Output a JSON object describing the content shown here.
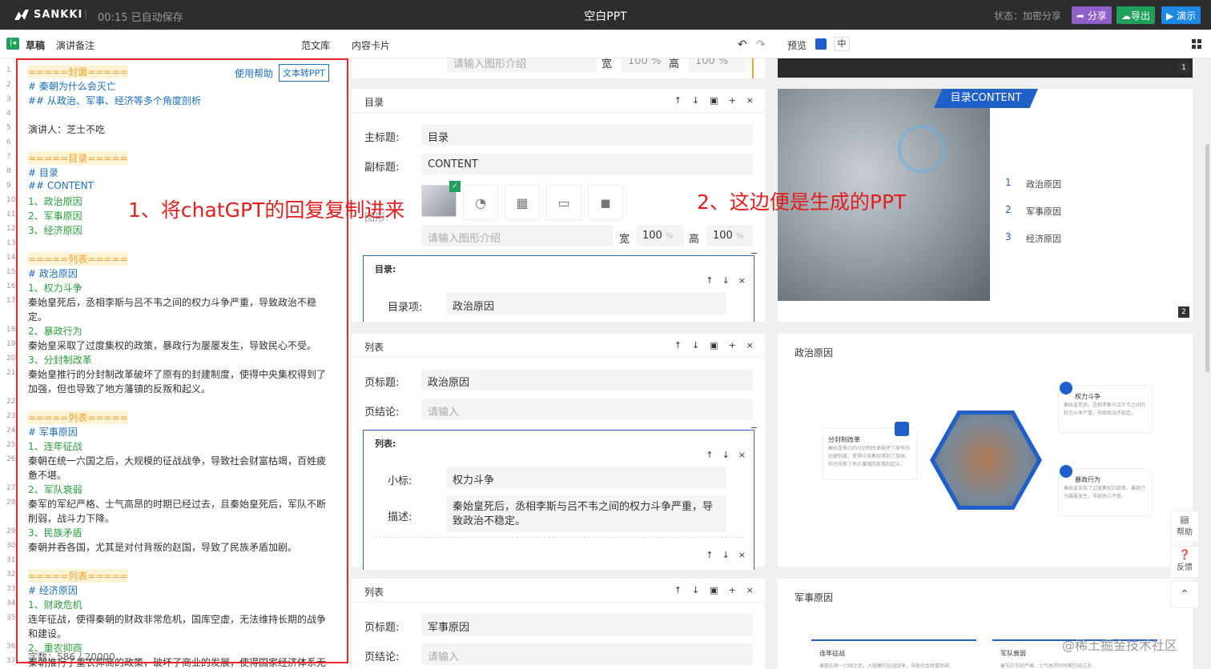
{
  "topbar": {
    "logo": "SANKKI",
    "separator": "|",
    "autosave": "00:15 已自动保存",
    "title": "空白PPT",
    "status": "状态：加密分享",
    "share": "分享",
    "export": "导出",
    "present": "演示"
  },
  "subbar": {
    "tab_draft": "草稿",
    "tab_notes": "演讲备注",
    "tab_templates": "范文库",
    "tab_cards": "内容卡片",
    "preview": "预览",
    "size": "中"
  },
  "editor": {
    "help_link": "使用帮助",
    "convert_button": "文本转PPT",
    "word_count": "字数：586 / 20000",
    "line_numbers": [
      "1",
      "2",
      "3",
      "4",
      "5",
      "6",
      "7",
      "8",
      "9",
      "10",
      "11",
      "12",
      "13",
      "14",
      "15",
      "16",
      "17",
      "",
      "18",
      "19",
      "20",
      "21",
      "",
      "22",
      "23",
      "24",
      "25",
      "26",
      "",
      "27",
      "28",
      "",
      "29",
      "30",
      "31",
      "32",
      "33",
      "34",
      "35",
      "",
      "36",
      "37"
    ],
    "lines": [
      {
        "t": "=====封面=====",
        "c": "mark-h"
      },
      {
        "t": "# 秦朝为什么会灭亡",
        "c": "blue"
      },
      {
        "t": "## 从政治、军事、经济等多个角度剖析",
        "c": "blue"
      },
      {
        "t": "",
        "c": ""
      },
      {
        "t": "演讲人：芝士不吃",
        "c": ""
      },
      {
        "t": "",
        "c": ""
      },
      {
        "t": "=====目录=====",
        "c": "mark-h"
      },
      {
        "t": "# 目录",
        "c": "blue"
      },
      {
        "t": "## CONTENT",
        "c": "blue"
      },
      {
        "t": "1、政治原因",
        "c": "green"
      },
      {
        "t": "2、军事原因",
        "c": "green"
      },
      {
        "t": "3、经济原因",
        "c": "green"
      },
      {
        "t": "",
        "c": ""
      },
      {
        "t": "=====列表=====",
        "c": "mark-h"
      },
      {
        "t": "# 政治原因",
        "c": "blue"
      },
      {
        "t": "1、权力斗争",
        "c": "green"
      },
      {
        "t": "秦始皇死后，丞相李斯与吕不韦之间的权力斗争严重，导致政治不稳",
        "c": ""
      },
      {
        "t": "定。",
        "c": ""
      },
      {
        "t": "2、暴政行为",
        "c": "green"
      },
      {
        "t": "秦始皇采取了过度集权的政策，暴政行为屡屡发生，导致民心不受。",
        "c": ""
      },
      {
        "t": "3、分封制改革",
        "c": "green"
      },
      {
        "t": "秦始皇推行的分封制改革破坏了原有的封建制度，使得中央集权得到了",
        "c": ""
      },
      {
        "t": "加强，但也导致了地方藩镇的反叛和起义。",
        "c": ""
      },
      {
        "t": "",
        "c": ""
      },
      {
        "t": "=====列表=====",
        "c": "mark-h"
      },
      {
        "t": "# 军事原因",
        "c": "blue"
      },
      {
        "t": "1、连年征战",
        "c": "green"
      },
      {
        "t": "秦朝在统一六国之后，大规模的征战战争，导致社会财富枯竭，百姓疲",
        "c": ""
      },
      {
        "t": "惫不堪。",
        "c": ""
      },
      {
        "t": "2、军队衰弱",
        "c": "green"
      },
      {
        "t": "秦军的军纪严格、士气高昂的时期已经过去，且秦始皇死后，军队不断",
        "c": ""
      },
      {
        "t": "削弱，战斗力下降。",
        "c": ""
      },
      {
        "t": "3、民族矛盾",
        "c": "green"
      },
      {
        "t": "秦朝并吞各国，尤其是对付背叛的赵国，导致了民族矛盾加剧。",
        "c": ""
      },
      {
        "t": "",
        "c": ""
      },
      {
        "t": "=====列表=====",
        "c": "mark-h"
      },
      {
        "t": "# 经济原因",
        "c": "blue"
      },
      {
        "t": "1、财政危机",
        "c": "green"
      },
      {
        "t": "连年征战，使得秦朝的财政非常危机，国库空虚，无法维持长期的战争",
        "c": ""
      },
      {
        "t": "和建设。",
        "c": ""
      },
      {
        "t": "2、重农抑商",
        "c": "green"
      },
      {
        "t": "秦朝推行了重农抑商的政策，破坏了商业的发展，使得国家经济体系无",
        "c": ""
      }
    ]
  },
  "annotations": {
    "left": "1、将chatGPT的回复复制进来",
    "right": "2、这边便是生成的PPT"
  },
  "form": {
    "top_ph": "请输入图形介绍",
    "w_label": "宽",
    "h_label": "高",
    "w_val": "100",
    "h_val": "100",
    "pct": "%",
    "toc_card": {
      "title": "目录",
      "main_label": "主标题:",
      "main_val": "目录",
      "sub_label": "副标题:",
      "sub_val": "CONTENT",
      "graphic_label": "图形:",
      "graphic_ph": "请输入图形介绍",
      "sub_title": "目录:",
      "item_label": "目录项:",
      "item_val": "政治原因"
    },
    "list_card1": {
      "title": "列表",
      "page_title_label": "页标题:",
      "page_title_val": "政治原因",
      "page_concl_label": "页结论:",
      "page_concl_ph": "请输入",
      "sub_title": "列表:",
      "small_label": "小标:",
      "small_val": "权力斗争",
      "desc_label": "描述:",
      "desc_val": "秦始皇死后，丞相李斯与吕不韦之间的权力斗争严重，导致政治不稳定。"
    },
    "list_card2": {
      "title": "列表",
      "page_title_label": "页标题:",
      "page_title_val": "军事原因",
      "page_concl_label": "页结论:",
      "page_concl_ph": "请输入"
    },
    "controls": {
      "up": "↑",
      "down": "↓",
      "copy": "▣",
      "add": "+",
      "close": "×",
      "collapse": "−"
    }
  },
  "preview": {
    "slide1_num": "1",
    "slide2": {
      "banner": "目录CONTENT",
      "num": "2",
      "items": [
        {
          "n": "1",
          "label": "政治原因"
        },
        {
          "n": "2",
          "label": "军事原因"
        },
        {
          "n": "3",
          "label": "经济原因"
        }
      ]
    },
    "slide3": {
      "title": "政治原因",
      "items": [
        {
          "title": "权力斗争",
          "desc": "秦始皇死后，丞相李斯与吕不韦之间的权力斗争严重，导致政治不稳定。"
        },
        {
          "title": "分封制改革",
          "desc": "秦始皇推行的分封制改革破坏了原有的封建制度，使得中央集权得到了加强，但也导致了地方藩镇的反叛和起义。"
        },
        {
          "title": "暴政行为",
          "desc": "秦始皇采取了过度集权的政策，暴政行为屡屡发生，导致民心不受。"
        }
      ]
    },
    "slide4": {
      "title": "军事原因",
      "col1_title": "连年征战",
      "col1_desc": "秦朝在统一六国之后，大规模的征战战争，导致社会财富枯竭",
      "col2_title": "军队衰弱",
      "col2_desc": "秦军的军纪严格、士气高昂的时期已经过去"
    },
    "help": "帮助",
    "feedback": "反馈",
    "watermark": "@稀土掘金技术社区"
  },
  "colors": {
    "accent": "#1e6fb8",
    "annotation": "#e02020",
    "share": "#8e5fc9",
    "export": "#1fa15c",
    "present": "#1e88e5"
  }
}
